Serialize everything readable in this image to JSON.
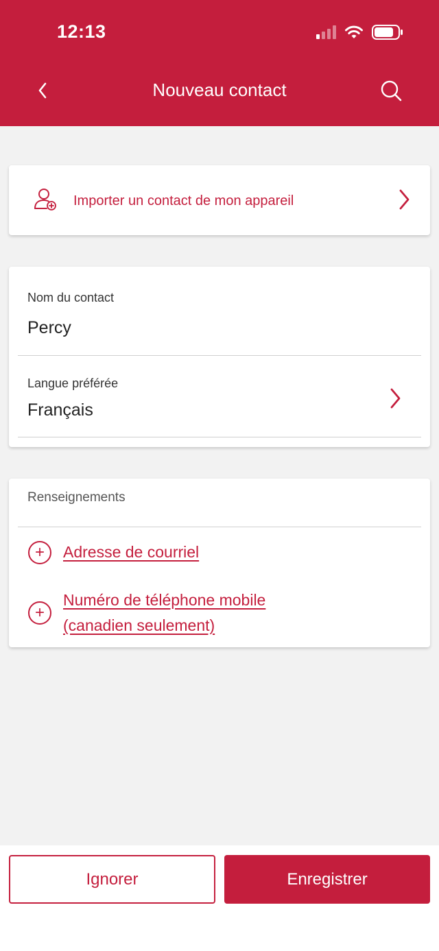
{
  "status_bar": {
    "time": "12:13"
  },
  "nav": {
    "title": "Nouveau contact"
  },
  "import": {
    "label": "Importer un contact de mon appareil"
  },
  "form": {
    "name_label": "Nom du contact",
    "name_value": "Percy",
    "language_label": "Langue préférée",
    "language_value": "Français"
  },
  "info": {
    "title": "Renseignements",
    "email_link": "Adresse de courriel",
    "phone_link_line1": "Numéro de téléphone mobile",
    "phone_link_line2": "(canadien seulement)"
  },
  "buttons": {
    "ignore": "Ignorer",
    "save": "Enregistrer"
  },
  "colors": {
    "brand": "#c41e3d",
    "background": "#f2f2f2"
  },
  "icons": [
    "back-chevron-icon",
    "search-icon",
    "add-person-icon",
    "chevron-right-icon",
    "plus-circle-icon",
    "signal-icon",
    "wifi-icon",
    "battery-icon"
  ]
}
